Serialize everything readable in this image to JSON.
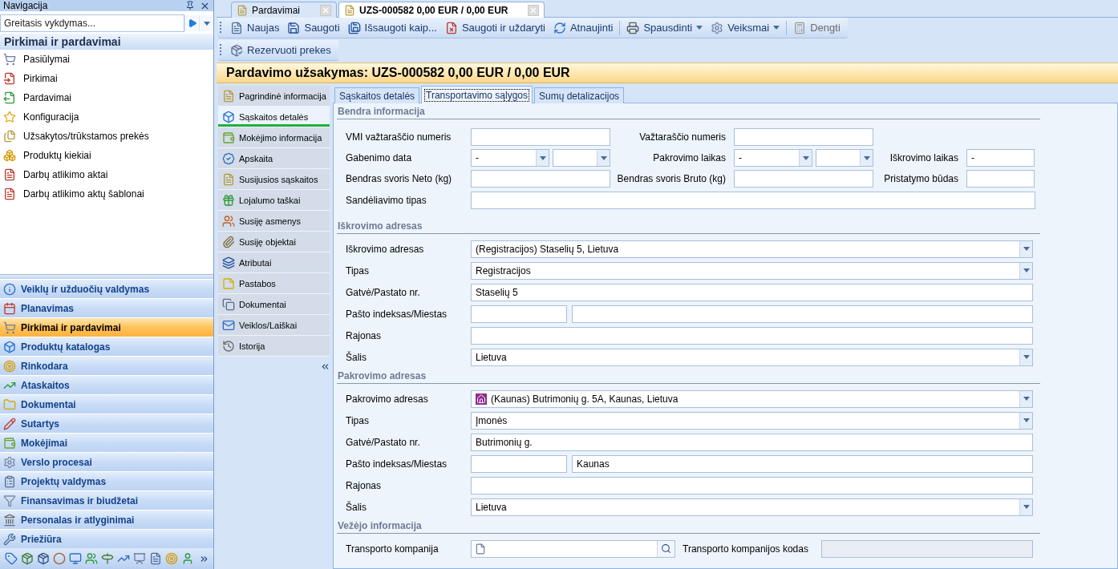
{
  "navigation": {
    "title": "Navigacija",
    "quick_run": {
      "placeholder": "Greitasis vykdymas..."
    },
    "section_title": "Pirkimai ir pardavimai",
    "items": [
      {
        "label": "Pasiūlymai"
      },
      {
        "label": "Pirkimai"
      },
      {
        "label": "Pardavimai"
      },
      {
        "label": "Konfiguracija"
      },
      {
        "label": "Užsakytos/trūkstamos prekės"
      },
      {
        "label": "Produktų kiekiai"
      },
      {
        "label": "Darbų atlikimo aktai"
      },
      {
        "label": "Darbų atlikimo aktų šablonai"
      }
    ],
    "modules": [
      {
        "label": "Veiklų ir užduočių valdymas",
        "selected": false
      },
      {
        "label": "Planavimas",
        "selected": false
      },
      {
        "label": "Pirkimai ir pardavimai",
        "selected": true
      },
      {
        "label": "Produktų katalogas",
        "selected": false
      },
      {
        "label": "Rinkodara",
        "selected": false
      },
      {
        "label": "Ataskaitos",
        "selected": false
      },
      {
        "label": "Dokumentai",
        "selected": false
      },
      {
        "label": "Sutartys",
        "selected": false
      },
      {
        "label": "Mokėjimai",
        "selected": false
      },
      {
        "label": "Verslo procesai",
        "selected": false
      },
      {
        "label": "Projektų valdymas",
        "selected": false
      },
      {
        "label": "Finansavimas ir biudžetai",
        "selected": false
      },
      {
        "label": "Personalas ir atlyginimai",
        "selected": false
      },
      {
        "label": "Priežiūra",
        "selected": false
      }
    ]
  },
  "document_tabs": [
    {
      "label": "Pardavimai",
      "selected": false
    },
    {
      "label": "UZS-000582 0,00 EUR / 0,00 EUR",
      "selected": true
    }
  ],
  "toolbar": {
    "groups": [
      [
        {
          "label": "Naujas",
          "dropdown": false,
          "disabled": false
        },
        {
          "label": "Saugoti",
          "dropdown": false,
          "disabled": false
        },
        {
          "label": "Išsaugoti kaip...",
          "dropdown": false,
          "disabled": false
        },
        {
          "label": "Saugoti ir uždaryti",
          "dropdown": false,
          "disabled": false
        },
        {
          "label": "Atnaujinti",
          "dropdown": false,
          "disabled": false
        }
      ],
      [
        {
          "label": "Spausdinti",
          "dropdown": true,
          "disabled": false
        },
        {
          "label": "Veiksmai",
          "dropdown": true,
          "disabled": false
        }
      ],
      [
        {
          "label": "Dengti",
          "dropdown": false,
          "disabled": true
        }
      ]
    ]
  },
  "secondary_toolbar": [
    {
      "label": "Rezervuoti prekes",
      "dropdown": false,
      "disabled": false
    }
  ],
  "document_title": "Pardavimo užsakymas: UZS-000582 0,00 EUR / 0,00 EUR",
  "side_tabs": [
    {
      "label": "Pagrindinė informacija",
      "selected": false
    },
    {
      "label": "Sąskaitos detalės",
      "selected": true
    },
    {
      "label": "Mokėjimo informacija",
      "selected": false
    },
    {
      "label": "Apskaita",
      "selected": false
    },
    {
      "label": "Susijusios sąskaitos",
      "selected": false
    },
    {
      "label": "Lojalumo taškai",
      "selected": false
    },
    {
      "label": "Susiję asmenys",
      "selected": false
    },
    {
      "label": "Susiję objektai",
      "selected": false
    },
    {
      "label": "Atributai",
      "selected": false
    },
    {
      "label": "Pastabos",
      "selected": false
    },
    {
      "label": "Dokumentai",
      "selected": false
    },
    {
      "label": "Veiklos/Laiškai",
      "selected": false
    },
    {
      "label": "Istorija",
      "selected": false
    }
  ],
  "form_tabs": [
    {
      "label": "Sąskaitos detalės",
      "selected": false
    },
    {
      "label": "Transportavimo sąlygos",
      "selected": true
    },
    {
      "label": "Sumų detalizacijos",
      "selected": false
    }
  ],
  "general": {
    "title": "Bendra informacija",
    "rows": [
      [
        {
          "label": "VMI važtaraščio numeris",
          "kind": "text"
        },
        {
          "label": "Važtaraščio numeris",
          "kind": "text"
        }
      ],
      [
        {
          "label": "Gabenimo data",
          "kind": "datetime",
          "value": "-"
        },
        {
          "label": "Pakrovimo laikas",
          "kind": "datetime",
          "value": "-"
        },
        {
          "label": "Iškrovimo laikas",
          "kind": "text",
          "value": "-"
        }
      ],
      [
        {
          "label": "Bendras svoris Neto (kg)",
          "kind": "text"
        },
        {
          "label": "Bendras svoris Bruto (kg)",
          "kind": "text"
        },
        {
          "label": "Pristatymo būdas",
          "kind": "text"
        }
      ],
      [
        {
          "label": "Sandėliavimo tipas",
          "kind": "wide"
        }
      ]
    ]
  },
  "sections": [
    {
      "title": "Iškrovimo adresas",
      "rows": [
        {
          "label": "Iškrovimo adresas",
          "kind": "select",
          "value": "(Registracijos) Staselių 5, Lietuva",
          "icon": false
        },
        {
          "label": "Tipas",
          "kind": "select",
          "value": "Registracijos",
          "icon": false
        },
        {
          "label": "Gatvė/Pastato nr.",
          "kind": "text",
          "value": "Staselių 5"
        },
        {
          "label": "Pašto indeksas/Miestas",
          "kind": "postcode_city"
        },
        {
          "label": "Rajonas",
          "kind": "text"
        },
        {
          "label": "Šalis",
          "kind": "select",
          "value": "Lietuva",
          "icon": false
        }
      ]
    },
    {
      "title": "Pakrovimo adresas",
      "rows": [
        {
          "label": "Pakrovimo adresas",
          "kind": "select",
          "value": "(Kaunas) Butrimonių g. 5A, Kaunas, Lietuva",
          "icon": true
        },
        {
          "label": "Tipas",
          "kind": "select",
          "value": "Įmonės",
          "icon": false
        },
        {
          "label": "Gatvė/Pastato nr.",
          "kind": "text",
          "value": "Butrimonių g."
        },
        {
          "label": "Pašto indeksas/Miestas",
          "kind": "postcode_city",
          "city": "Kaunas"
        },
        {
          "label": "Rajonas",
          "kind": "text"
        },
        {
          "label": "Šalis",
          "kind": "select",
          "value": "Lietuva",
          "icon": false
        }
      ]
    },
    {
      "title": "Vežėjo informacija",
      "rows": [
        {
          "label": "Transporto kompanija",
          "kind": "lookup",
          "secondary": {
            "label": "Transporto kompanijos kodas",
            "disabled": true
          }
        }
      ]
    }
  ]
}
